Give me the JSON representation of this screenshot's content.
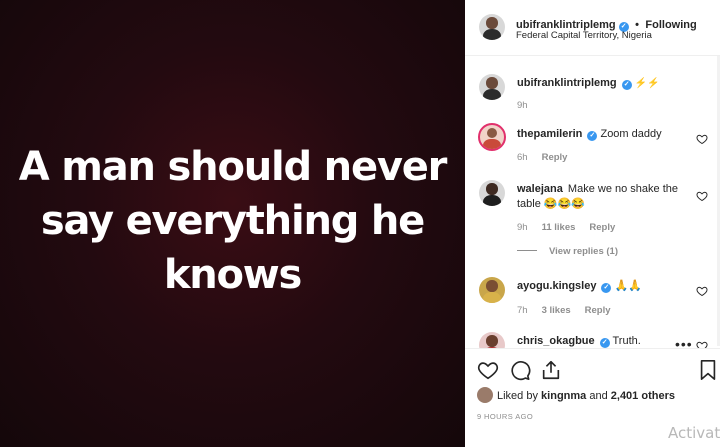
{
  "media": {
    "text": "A man should never say everything he knows"
  },
  "header": {
    "username": "ubifranklintriplemg",
    "separator": "•",
    "following": "Following",
    "location": "Federal Capital Territory, Nigeria"
  },
  "caption": {
    "username": "ubifranklintriplemg",
    "text": "⚡⚡",
    "time": "9h"
  },
  "comments": [
    {
      "username": "thepamilerin",
      "text": "Zoom daddy",
      "time": "6h",
      "likes": "",
      "reply": "Reply"
    },
    {
      "username": "walejana",
      "text": "Make we no shake the table 😂😂😂",
      "time": "9h",
      "likes": "11 likes",
      "reply": "Reply",
      "view_replies": "View replies (1)"
    },
    {
      "username": "ayogu.kingsley",
      "text": "🙏🙏",
      "time": "7h",
      "likes": "3 likes",
      "reply": "Reply"
    },
    {
      "username": "chris_okagbue",
      "text": "Truth.",
      "time": "",
      "likes": "",
      "reply": ""
    }
  ],
  "likes": {
    "prefix": "Liked by",
    "user": "kingnma",
    "and": "and",
    "others": "2,401 others"
  },
  "timestamp": "9 HOURS AGO",
  "overlay": {
    "activate": "Activate"
  },
  "icons": {
    "heart": "heart-icon",
    "comment": "comment-icon",
    "share": "share-icon",
    "save": "bookmark-icon",
    "more": "more-icon"
  },
  "colors": {
    "verified": "#3897f0",
    "muted": "#8e8e8e",
    "text": "#262626"
  }
}
